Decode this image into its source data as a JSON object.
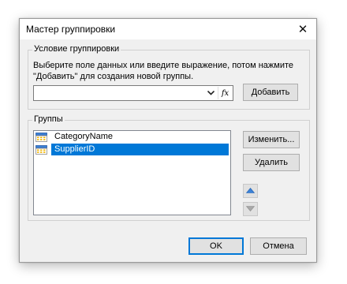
{
  "window": {
    "title": "Мастер группировки",
    "close_symbol": "✕"
  },
  "condition": {
    "legend": "Условие группировки",
    "hint_line1": "Выберите поле данных или введите выражение, потом нажмите",
    "hint_line2": "\"Добавить\" для создания новой группы.",
    "expression_value": "",
    "fx_label": "fx",
    "add_label": "Добавить"
  },
  "groups": {
    "legend": "Группы",
    "items": [
      {
        "label": "CategoryName",
        "icon": "group-icon",
        "selected": false
      },
      {
        "label": "SupplierID",
        "icon": "group-icon",
        "selected": true
      }
    ],
    "edit_label": "Изменить...",
    "delete_label": "Удалить",
    "move_up_icon": "arrow-up-icon",
    "move_down_icon": "arrow-down-icon"
  },
  "footer": {
    "ok_label": "OK",
    "cancel_label": "Отмена"
  },
  "colors": {
    "accent": "#0078d7",
    "selection": "#0078d7",
    "dialog_bg": "#f0f0f0"
  }
}
